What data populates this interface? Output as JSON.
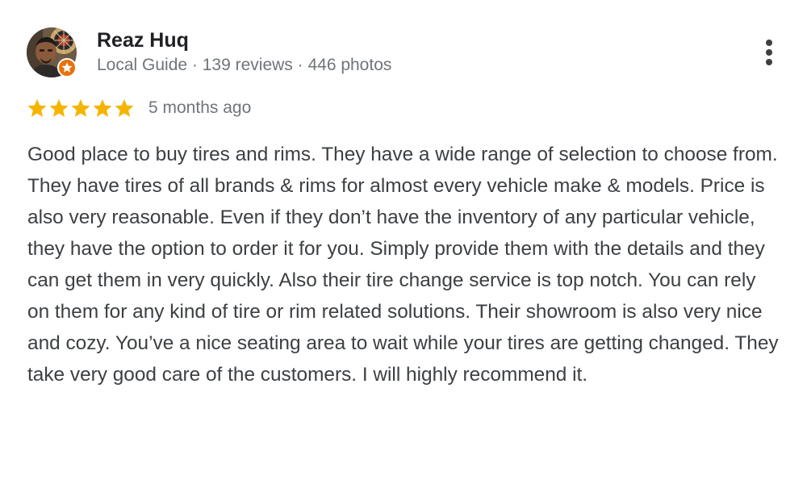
{
  "review": {
    "author": {
      "name": "Reaz Huq",
      "meta": "Local Guide · 139 reviews · 446 photos",
      "avatar_icon": "profile-photo",
      "badge_icon": "local-guide-star-badge"
    },
    "menu_icon": "more-vert-icon",
    "rating": {
      "stars": 5,
      "max": 5,
      "star_color": "#f4b400",
      "date": "5 months ago"
    },
    "text": "Good place to buy tires and rims. They have a wide range of selection to choose from. They have tires of all brands & rims for almost every vehicle make & models. Price is also very reasonable. Even if they don’t have the inventory of any particular vehicle, they have the option to order it for you. Simply provide them with the details and they can get them in very quickly. Also their tire change service is top notch. You can rely on them for any kind of tire or rim related solutions. Their showroom is also very nice and cozy. You’ve a nice seating area to wait while your tires are getting changed. They take very good care of the customers. I will highly recommend it."
  },
  "colors": {
    "name": "#202124",
    "meta": "#70757a",
    "body": "#3c4043",
    "badge": "#e8710a"
  }
}
